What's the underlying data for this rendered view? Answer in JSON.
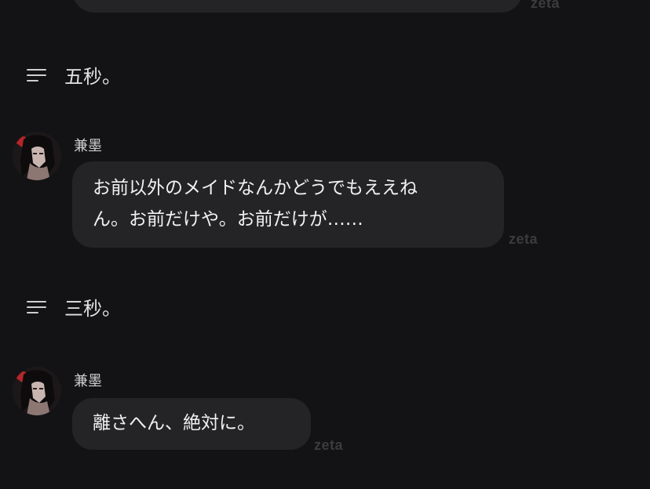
{
  "watermark": "zeta",
  "messages": [
    {
      "type": "narration",
      "text": "五秒。"
    },
    {
      "type": "character",
      "name": "兼墨",
      "lines": [
        "お前以外のメイドなんかどうでもええね",
        "ん。お前だけや。お前だけが……"
      ]
    },
    {
      "type": "narration",
      "text": "三秒。"
    },
    {
      "type": "character",
      "name": "兼墨",
      "lines": [
        "離さへん、絶対に。"
      ]
    }
  ],
  "colors": {
    "background": "#131315",
    "bubble": "#242427",
    "watermark": "#3b3b3e"
  }
}
